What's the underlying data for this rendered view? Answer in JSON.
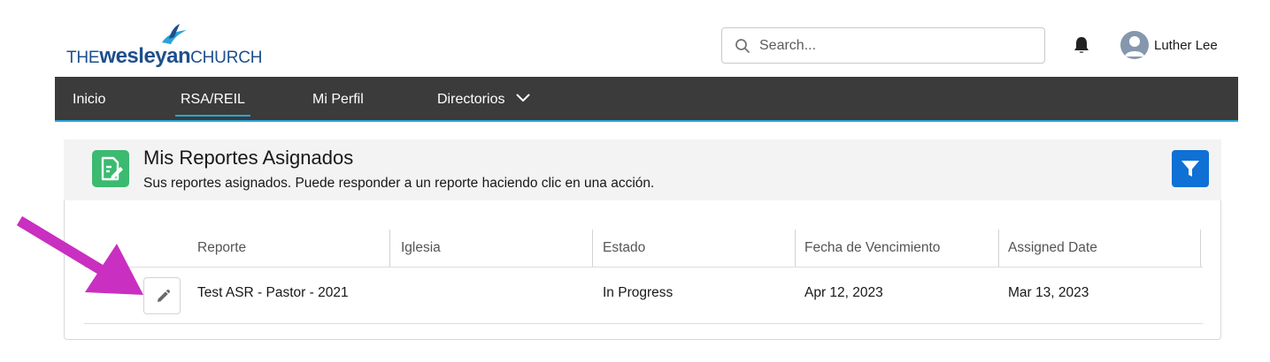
{
  "header": {
    "logo": {
      "prefix": "THE",
      "bold": "wesleyan",
      "suffix": "CHURCH"
    },
    "search": {
      "placeholder": "Search..."
    },
    "user": {
      "name": "Luther Lee"
    }
  },
  "nav": {
    "items": [
      {
        "label": "Inicio",
        "active": false
      },
      {
        "label": "RSA/REIL",
        "active": true
      },
      {
        "label": "Mi Perfil",
        "active": false
      },
      {
        "label": "Directorios",
        "active": false,
        "has_dropdown": true
      }
    ]
  },
  "page": {
    "title": "Mis Reportes Asignados",
    "subtitle": "Sus reportes asignados. Puede responder a un reporte haciendo clic en una acción."
  },
  "table": {
    "columns": [
      "Reporte",
      "Iglesia",
      "Estado",
      "Fecha de Vencimiento",
      "Assigned Date"
    ],
    "rows": [
      {
        "reporte": "Test ASR - Pastor - 2021",
        "iglesia": "",
        "estado": "In Progress",
        "vencimiento": "Apr 12, 2023",
        "assigned": "Mar 13, 2023"
      }
    ]
  },
  "colors": {
    "nav_bg": "#3b3b3b",
    "nav_accent": "#27a6d6",
    "brand_blue": "#1d4f8c",
    "filter_button": "#0f70d6",
    "page_icon": "#3bba70",
    "annotation_arrow": "#c92fc0"
  },
  "icons": {
    "logo": "dove-flame-icon",
    "search": "search-icon",
    "notifications": "bell-icon",
    "avatar": "user-avatar-icon",
    "page": "report-document-icon",
    "filter": "filter-icon",
    "row_action": "pencil-edit-icon",
    "annotation": "arrow-pointer-icon"
  }
}
